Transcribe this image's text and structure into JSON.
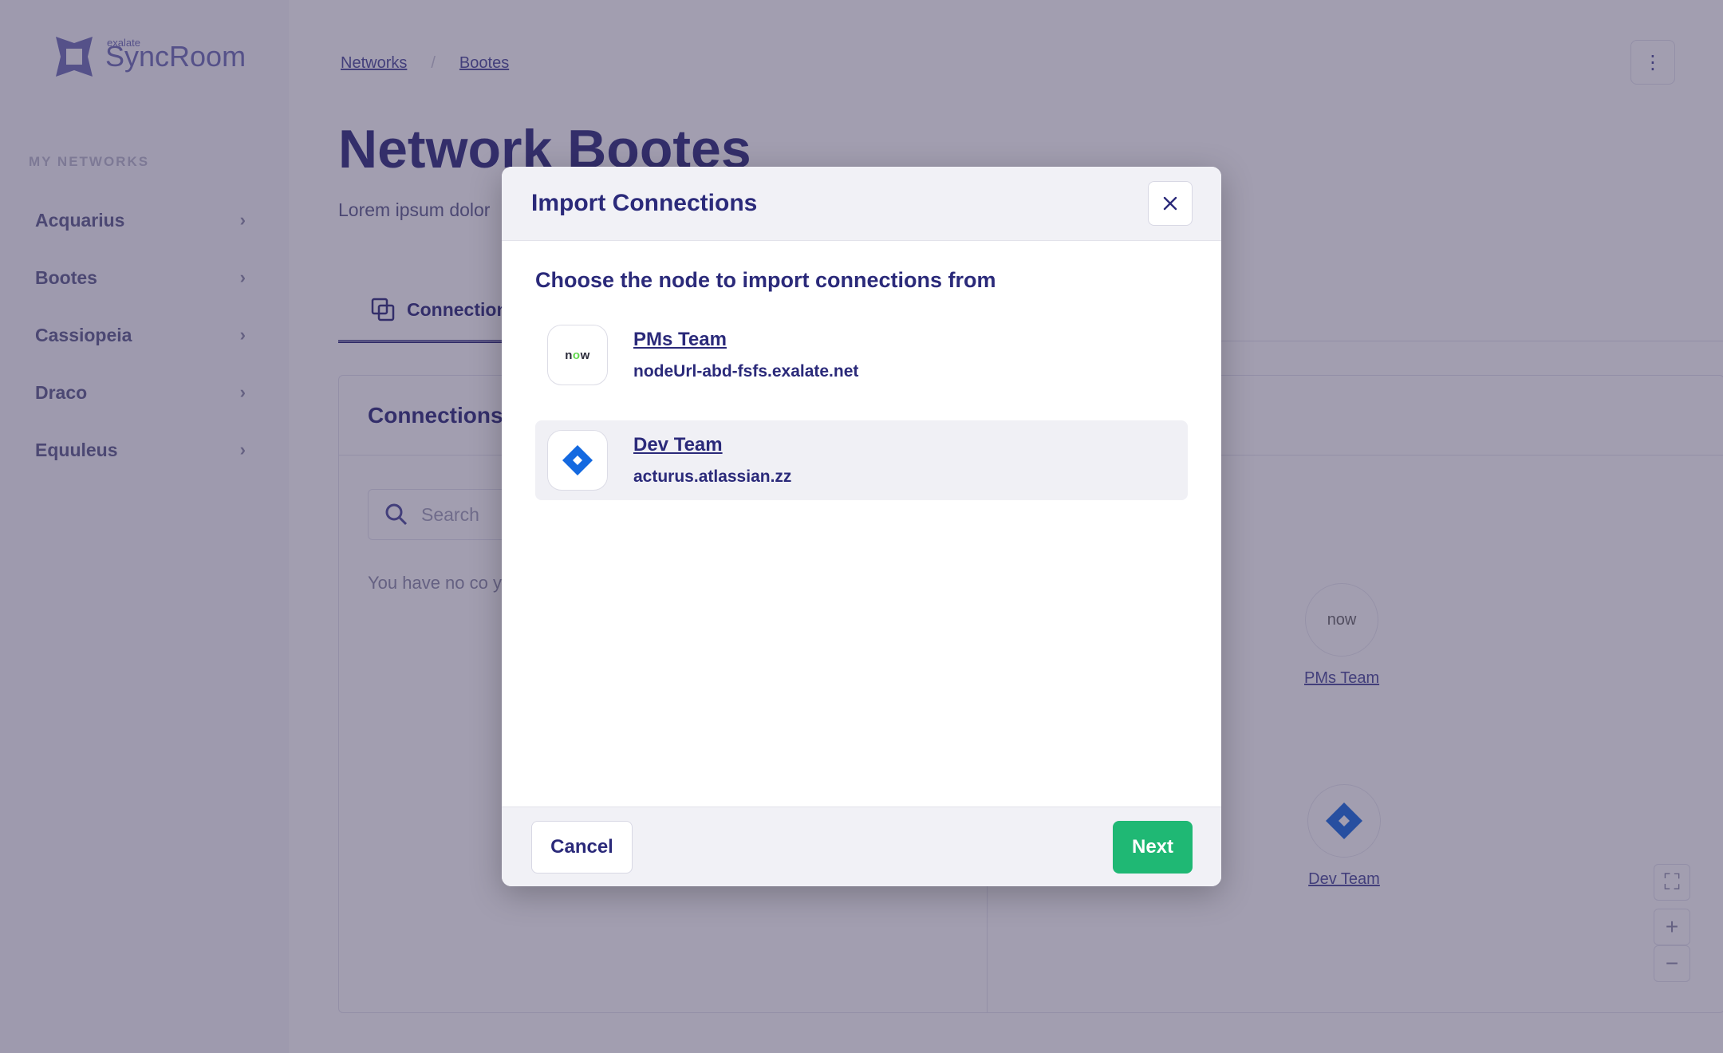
{
  "brand": {
    "small": "exalate",
    "name": "SyncRoom"
  },
  "sidebar": {
    "section_label": "MY NETWORKS",
    "items": [
      {
        "label": "Acquarius"
      },
      {
        "label": "Bootes"
      },
      {
        "label": "Cassiopeia"
      },
      {
        "label": "Draco"
      },
      {
        "label": "Equuleus"
      }
    ]
  },
  "breadcrumb": {
    "items": [
      "Networks",
      "Bootes"
    ]
  },
  "page": {
    "title": "Network Bootes",
    "description": "Lorem ipsum dolor",
    "tab_label": "Connection",
    "panel_title": "Connections",
    "search_placeholder": "Search",
    "empty_message": "You have no co your network."
  },
  "map": {
    "nodes": [
      {
        "label": "PMs Team",
        "icon": "servicenow-logo",
        "icon_text": "now"
      },
      {
        "label": "Dev Team",
        "icon": "jira-diamond-icon"
      }
    ]
  },
  "modal": {
    "title": "Import Connections",
    "subtitle": "Choose the node to import connections from",
    "nodes": [
      {
        "name": "PMs Team",
        "url": "nodeUrl-abd-fsfs.exalate.net",
        "icon": "servicenow-logo",
        "icon_text_1": "n",
        "icon_text_2": "o",
        "icon_text_3": "w",
        "selected": false
      },
      {
        "name": "Dev Team",
        "url": "acturus.atlassian.zz",
        "icon": "jira-diamond-icon",
        "selected": true
      }
    ],
    "cancel_label": "Cancel",
    "next_label": "Next"
  },
  "colors": {
    "primary_text": "#2b2a7a",
    "next_button": "#1fb874",
    "jira_blue": "#1469e0",
    "now_green": "#62d84e"
  }
}
